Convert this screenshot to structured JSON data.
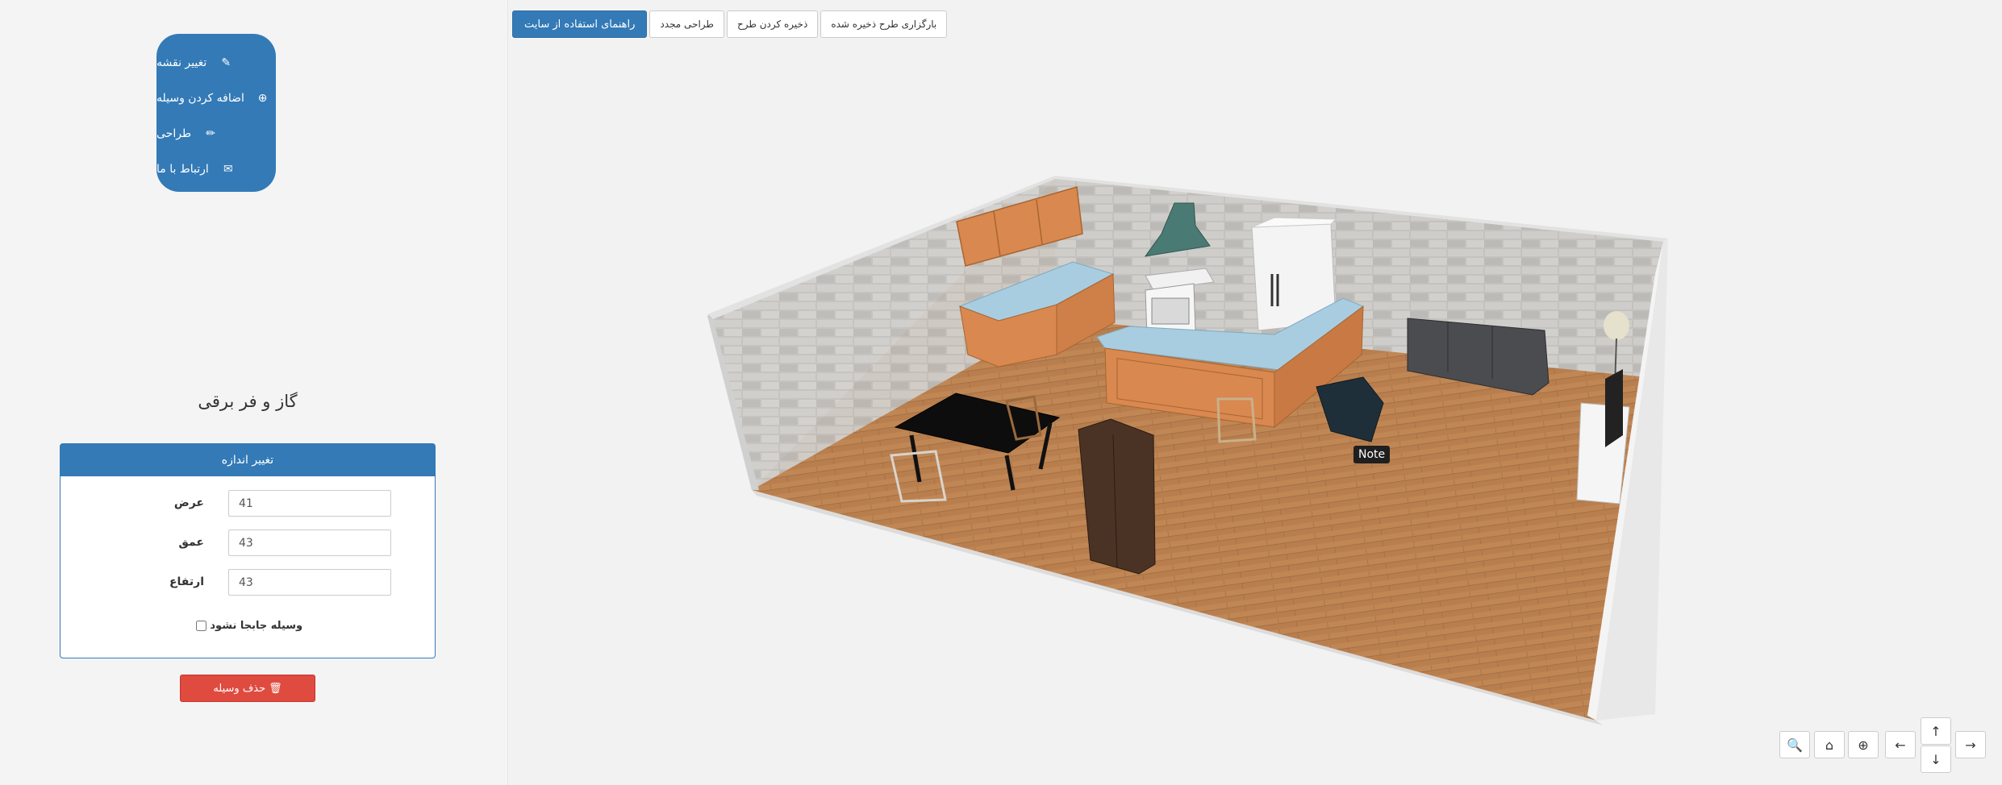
{
  "sidebar": {
    "nav": [
      {
        "label": "تغییر نقشه",
        "icon": "edit-icon",
        "glyph": "✎"
      },
      {
        "label": "اضافه کردن وسیله",
        "icon": "plus-circle-icon",
        "glyph": "⊕"
      },
      {
        "label": "طراحی",
        "icon": "pencil-icon",
        "glyph": "✏"
      },
      {
        "label": "ارتباط با ما",
        "icon": "envelope-icon",
        "glyph": "✉"
      }
    ],
    "item_title": "گاز و فر برقی",
    "resize_panel": {
      "heading": "تغییر اندازه",
      "width_label": "عرض",
      "width_value": "41",
      "depth_label": "عمق",
      "depth_value": "43",
      "height_label": "ارتفاع",
      "height_value": "43",
      "lock_label": "وسیله جابجا نشود"
    },
    "delete_label": "حذف وسیله",
    "delete_icon": "trash-icon"
  },
  "toolbar": {
    "guide": "راهنمای استفاده از سایت",
    "redesign": "طراحی مجدد",
    "save": "ذخیره کردن طرح",
    "load": "بارگزاری طرح ذخیره شده"
  },
  "viewport": {
    "note": "Note"
  },
  "camera_controls": {
    "zoom_out": "zoom-out-icon",
    "home": "home-icon",
    "zoom_in": "zoom-in-icon",
    "left": "arrow-left-icon",
    "up": "arrow-up-icon",
    "down": "arrow-down-icon",
    "right": "arrow-right-icon"
  },
  "colors": {
    "primary": "#337ab7",
    "danger": "#e04b3f",
    "floor": "#b97e4e",
    "wall": "#bfbdb9",
    "cabinet": "#d98850",
    "countertop": "#a9cde0"
  }
}
